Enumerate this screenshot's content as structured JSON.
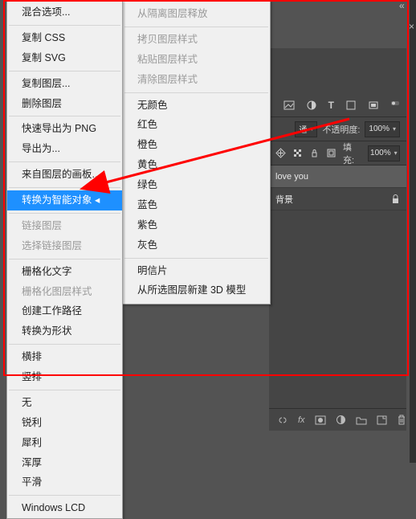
{
  "menu_left": {
    "items": [
      {
        "label": "混合选项...",
        "type": "item"
      },
      {
        "type": "sep"
      },
      {
        "label": "复制 CSS",
        "type": "item"
      },
      {
        "label": "复制 SVG",
        "type": "item"
      },
      {
        "type": "sep"
      },
      {
        "label": "复制图层...",
        "type": "item"
      },
      {
        "label": "删除图层",
        "type": "item"
      },
      {
        "type": "sep"
      },
      {
        "label": "快速导出为 PNG",
        "type": "item"
      },
      {
        "label": "导出为...",
        "type": "item"
      },
      {
        "type": "sep"
      },
      {
        "label": "来自图层的画板...",
        "type": "item"
      },
      {
        "type": "sep"
      },
      {
        "label": "转换为智能对象",
        "type": "item",
        "selected": true
      },
      {
        "type": "sep"
      },
      {
        "label": "链接图层",
        "type": "item",
        "disabled": true
      },
      {
        "label": "选择链接图层",
        "type": "item",
        "disabled": true
      },
      {
        "type": "sep"
      },
      {
        "label": "栅格化文字",
        "type": "item"
      },
      {
        "label": "栅格化图层样式",
        "type": "item",
        "disabled": true
      },
      {
        "label": "创建工作路径",
        "type": "item"
      },
      {
        "label": "转换为形状",
        "type": "item"
      },
      {
        "type": "sep"
      },
      {
        "label": "横排",
        "type": "item"
      },
      {
        "label": "竖排",
        "type": "item"
      },
      {
        "type": "sep"
      },
      {
        "label": "无",
        "type": "item"
      },
      {
        "label": "锐利",
        "type": "item"
      },
      {
        "label": "犀利",
        "type": "item"
      },
      {
        "label": "浑厚",
        "type": "item"
      },
      {
        "label": "平滑",
        "type": "item"
      },
      {
        "type": "sep"
      },
      {
        "label": "Windows LCD",
        "type": "item"
      }
    ]
  },
  "menu_right": {
    "items": [
      {
        "label": "从隔离图层释放",
        "type": "item",
        "disabled": true
      },
      {
        "type": "sep"
      },
      {
        "label": "拷贝图层样式",
        "type": "item",
        "disabled": true
      },
      {
        "label": "粘贴图层样式",
        "type": "item",
        "disabled": true
      },
      {
        "label": "清除图层样式",
        "type": "item",
        "disabled": true
      },
      {
        "type": "sep"
      },
      {
        "label": "无颜色",
        "type": "item"
      },
      {
        "label": "红色",
        "type": "item"
      },
      {
        "label": "橙色",
        "type": "item"
      },
      {
        "label": "黄色",
        "type": "item"
      },
      {
        "label": "绿色",
        "type": "item"
      },
      {
        "label": "蓝色",
        "type": "item"
      },
      {
        "label": "紫色",
        "type": "item"
      },
      {
        "label": "灰色",
        "type": "item"
      },
      {
        "type": "sep"
      },
      {
        "label": "明信片",
        "type": "item"
      },
      {
        "label": "从所选图层新建 3D 模型",
        "type": "item"
      }
    ]
  },
  "layers_panel": {
    "collapse_glyph": "«",
    "close_glyph": "×",
    "menu_glyph": "≡",
    "filter_icons": [
      "image",
      "adjust",
      "text",
      "shape",
      "smart"
    ],
    "blend_mode": "通",
    "opacity_label": "不透明度:",
    "opacity_value": "100%",
    "lock_labels": [
      "move",
      "pixels",
      "position",
      "artboard"
    ],
    "fill_label": "填充:",
    "fill_value": "100%",
    "layers": [
      {
        "name": "love you",
        "selected": true,
        "locked": false
      },
      {
        "name": "背景",
        "selected": false,
        "locked": true
      }
    ],
    "bottom_icons": [
      "link",
      "fx",
      "mask",
      "adjustment",
      "group",
      "new",
      "trash"
    ]
  },
  "colors": {
    "menu_highlight": "#1e90ff",
    "red_outline": "#ff0000"
  }
}
